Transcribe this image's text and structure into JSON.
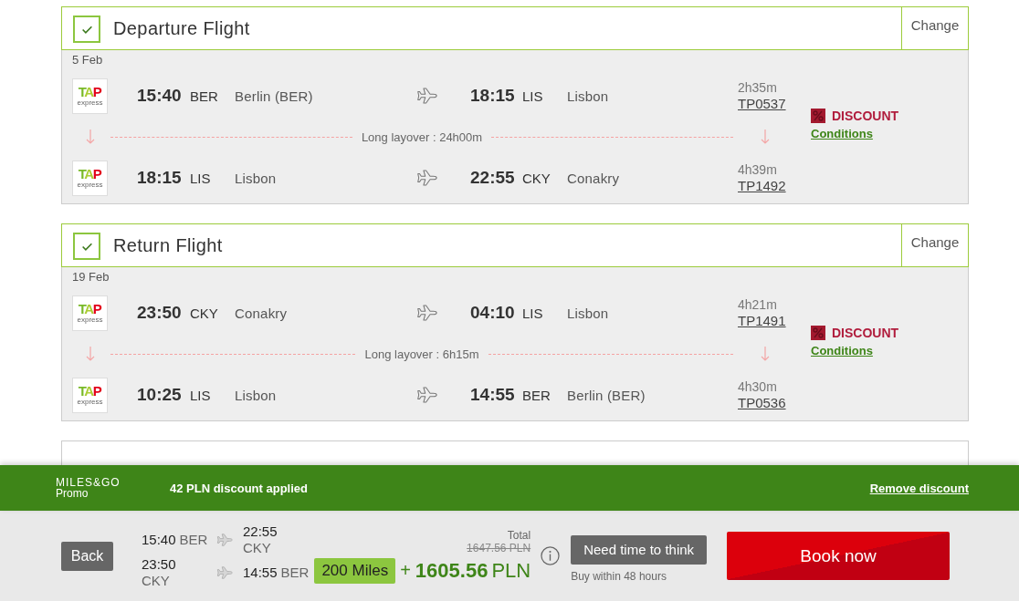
{
  "flights": [
    {
      "title": "Departure Flight",
      "checked": true,
      "change_label": "Change",
      "date": "5 Feb",
      "segments": [
        {
          "logo": {
            "name": "TAP",
            "tagline": "express"
          },
          "departure_time": "15:40",
          "departure_code": "BER",
          "departure_city": "Berlin (BER)",
          "arrival_time": "18:15",
          "arrival_code": "LIS",
          "arrival_city": "Lisbon",
          "duration": "2h35m",
          "flight_number": "TP0537"
        },
        {
          "logo": {
            "name": "TAP",
            "tagline": "express"
          },
          "departure_time": "18:15",
          "departure_code": "LIS",
          "departure_city": "Lisbon",
          "arrival_time": "22:55",
          "arrival_code": "CKY",
          "arrival_city": "Conakry",
          "duration": "4h39m",
          "flight_number": "TP1492"
        }
      ],
      "layovers": [
        "Long layover : 24h00m"
      ],
      "fare": {
        "label": "DISCOUNT",
        "link": "Conditions"
      }
    },
    {
      "title": "Return Flight",
      "checked": true,
      "change_label": "Change",
      "date": "19 Feb",
      "segments": [
        {
          "logo": {
            "name": "TAP",
            "tagline": "express"
          },
          "departure_time": "23:50",
          "departure_code": "CKY",
          "departure_city": "Conakry",
          "arrival_time": "04:10",
          "arrival_code": "LIS",
          "arrival_city": "Lisbon",
          "duration": "4h21m",
          "flight_number": "TP1491"
        },
        {
          "logo": {
            "name": "TAP",
            "tagline": "express"
          },
          "departure_time": "10:25",
          "departure_code": "LIS",
          "departure_city": "Lisbon",
          "arrival_time": "14:55",
          "arrival_code": "BER",
          "arrival_city": "Berlin (BER)",
          "duration": "4h30m",
          "flight_number": "TP0536"
        }
      ],
      "layovers": [
        "Long layover : 6h15m"
      ],
      "fare": {
        "label": "DISCOUNT",
        "link": "Conditions"
      }
    }
  ],
  "promo_bar": {
    "brand": "MILES&GO",
    "brand_sub": "Promo",
    "message": "42 PLN discount applied",
    "remove_link": "Remove discount"
  },
  "summary": {
    "back_button": "Back",
    "legs": [
      {
        "departure_time": "15:40",
        "departure_code": "BER",
        "arrival_time": "22:55",
        "arrival_code": "CKY"
      },
      {
        "departure_time": "23:50",
        "departure_code": "CKY",
        "arrival_time": "14:55",
        "arrival_code": "BER"
      }
    ],
    "total_label": "Total",
    "old_price": "1647.56 PLN",
    "miles": "200 Miles",
    "plus": "+",
    "price_amount": "1605.56",
    "price_currency": "PLN",
    "hold_button": "Need time to think",
    "hold_note": "Buy within 48 hours",
    "book_button": "Book now"
  }
}
